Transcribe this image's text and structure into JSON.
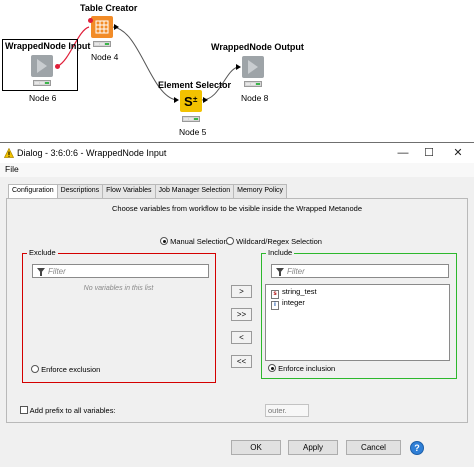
{
  "workflow": {
    "nodes": [
      {
        "id": "table-creator",
        "title": "Table Creator",
        "label": "Node 4"
      },
      {
        "id": "wrapped-input",
        "title": "WrappedNode Input",
        "label": "Node 6"
      },
      {
        "id": "element-selector",
        "title": "Element Selector",
        "label": "Node 5"
      },
      {
        "id": "wrapped-output",
        "title": "WrappedNode Output",
        "label": "Node 8"
      }
    ],
    "colors": {
      "connection": "#555555",
      "variable_connection": "#e0203a",
      "table_creator": "#f28c28",
      "element_selector": "#f2c200",
      "wrapped_node": "#9ea4a8",
      "status_green": "#3bb54a"
    }
  },
  "dialog": {
    "title": "Dialog - 3:6:0:6 - WrappedNode Input",
    "controls": {
      "minimize": "—",
      "maximize": "☐",
      "close": "✕"
    },
    "menu": {
      "file": "File"
    },
    "tabs": [
      "Configuration",
      "Descriptions",
      "Flow Variables",
      "Job Manager Selection",
      "Memory Policy"
    ],
    "active_tab": "Configuration",
    "instruction": "Choose variables from workflow to be visible inside the Wrapped Metanode",
    "mode": {
      "manual": "Manual Selection",
      "wildcard": "Wildcard/Regex Selection",
      "selected": "manual"
    },
    "exclude": {
      "legend": "Exclude",
      "filter_placeholder": "Filter",
      "empty_message": "No variables in this list",
      "enforce_label": "Enforce exclusion",
      "border_color": "#d40000"
    },
    "include": {
      "legend": "Include",
      "filter_placeholder": "Filter",
      "items": [
        {
          "type": "s",
          "name": "string_test"
        },
        {
          "type": "i",
          "name": "integer"
        }
      ],
      "enforce_label": "Enforce inclusion",
      "border_color": "#2db82d"
    },
    "move_buttons": {
      "add": ">",
      "add_all": ">>",
      "remove": "<",
      "remove_all": "<<"
    },
    "prefix": {
      "label": "Add prefix to all variables:",
      "value": "outer."
    },
    "buttons": {
      "ok": "OK",
      "apply": "Apply",
      "cancel": "Cancel",
      "help": "?"
    }
  }
}
